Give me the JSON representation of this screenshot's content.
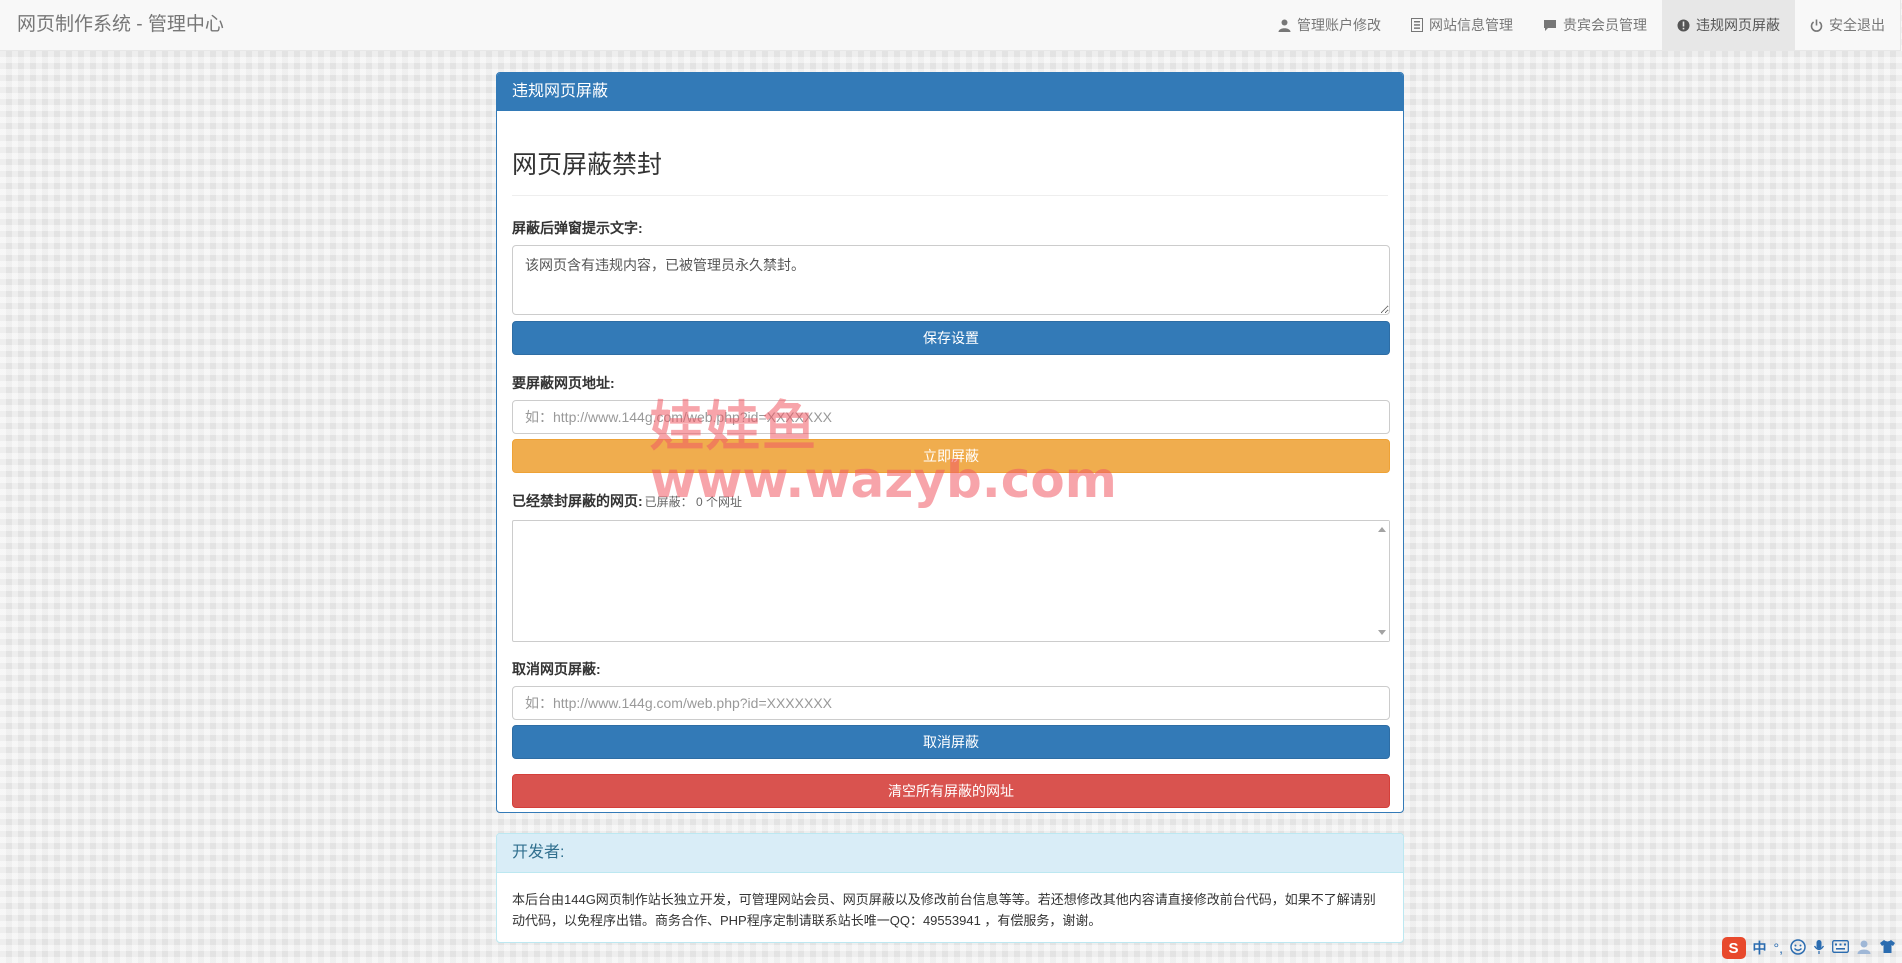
{
  "brand": "网页制作系统 - 管理中心",
  "nav": [
    {
      "label": "管理账户修改",
      "icon": "user-icon",
      "active": false
    },
    {
      "label": "网站信息管理",
      "icon": "list-icon",
      "active": false
    },
    {
      "label": "贵宾会员管理",
      "icon": "comment-icon",
      "active": false
    },
    {
      "label": "违规网页屏蔽",
      "icon": "exclamation-icon",
      "active": true
    },
    {
      "label": "安全退出",
      "icon": "power-icon",
      "active": false
    }
  ],
  "panel": {
    "heading": "违规网页屏蔽",
    "title": "网页屏蔽禁封",
    "popup_label": "屏蔽后弹窗提示文字:",
    "popup_value": "该网页含有违规内容，已被管理员永久禁封。",
    "save_button": "保存设置",
    "block_label": "要屏蔽网页地址:",
    "block_placeholder": "如：http://www.144g.com/web.php?id=XXXXXXX",
    "block_button": "立即屏蔽",
    "blocked_label": "已经禁封屏蔽的网页:",
    "blocked_count_text": "已屏蔽： 0 个网址",
    "unblock_label": "取消网页屏蔽:",
    "unblock_placeholder": "如：http://www.144g.com/web.php?id=XXXXXXX",
    "unblock_button": "取消屏蔽",
    "clear_button": "清空所有屏蔽的网址"
  },
  "developer": {
    "heading": "开发者:",
    "text": "本后台由144G网页制作站长独立开发，可管理网站会员、网页屏蔽以及修改前台信息等等。若还想修改其他内容请直接修改前台代码，如果不了解请别动代码，以免程序出错。商务合作、PHP程序定制请联系站长唯一QQ：49553941 ，有偿服务，谢谢。"
  },
  "watermark": {
    "line1": "娃娃鱼",
    "line2": "www.wazyb.com"
  },
  "tray": {
    "ime_logo": "S",
    "ime_mode": "中",
    "punct": "°,"
  },
  "colors": {
    "primary": "#337ab7",
    "warning": "#f0ad4e",
    "danger": "#d9534f",
    "info_bg": "#d9edf7",
    "watermark": "#f05a64"
  }
}
